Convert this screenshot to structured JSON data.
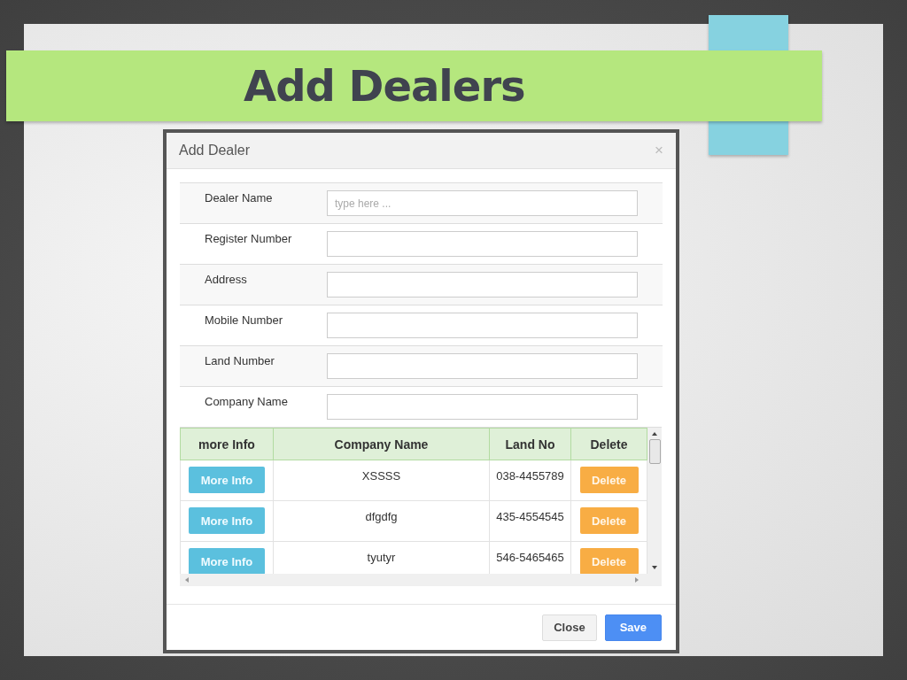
{
  "slide": {
    "title": "Add Dealers"
  },
  "dialog": {
    "title": "Add Dealer",
    "close_glyph": "×",
    "fields": [
      {
        "label": "Dealer Name",
        "placeholder": "type here ..."
      },
      {
        "label": "Register Number"
      },
      {
        "label": "Address"
      },
      {
        "label": "Mobile Number"
      },
      {
        "label": "Land Number"
      },
      {
        "label": "Company Name"
      }
    ],
    "table": {
      "columns": [
        "more Info",
        "Company Name",
        "Land No",
        "Delete"
      ],
      "rows": [
        {
          "info_button": "More Info",
          "company_name": "XSSSS",
          "land_no": "038-4455789",
          "delete_button": "Delete"
        },
        {
          "info_button": "More Info",
          "company_name": "dfgdfg",
          "land_no": "435-4554545",
          "delete_button": "Delete"
        },
        {
          "info_button": "More Info",
          "company_name": "tyutyr",
          "land_no": "546-5465465",
          "delete_button": "Delete"
        }
      ]
    },
    "buttons": [
      {
        "label": "Close",
        "kind": "default"
      },
      {
        "label": "Save",
        "kind": "primary"
      }
    ]
  }
}
